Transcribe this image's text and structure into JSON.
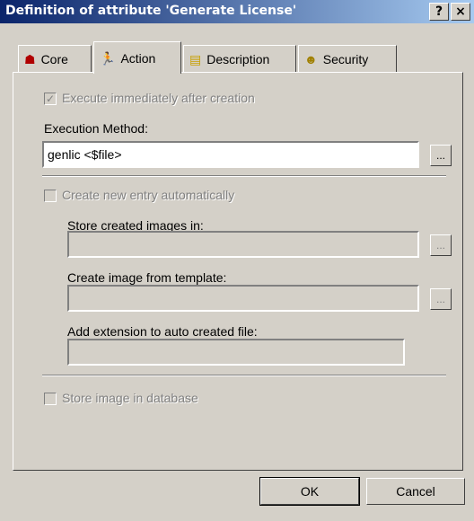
{
  "window": {
    "title": "Definition of attribute 'Generate License'",
    "help_glyph": "?",
    "close_glyph": "×"
  },
  "tabs": [
    {
      "label": "Core",
      "icon": "core-icon",
      "glyph": "☗",
      "icon_color": "#b00000",
      "active": false
    },
    {
      "label": "Action",
      "icon": "running-man-icon",
      "glyph": "🏃",
      "icon_color": "#000000",
      "active": true
    },
    {
      "label": "Description",
      "icon": "note-icon",
      "glyph": "▤",
      "icon_color": "#c8a000",
      "active": false
    },
    {
      "label": "Security",
      "icon": "people-icon",
      "glyph": "☻",
      "icon_color": "#a08000",
      "active": false
    }
  ],
  "action": {
    "execute_immediately": {
      "label": "Execute immediately after creation",
      "checked": true,
      "check_glyph": "✓",
      "enabled": false
    },
    "execution_method": {
      "label": "Execution Method:",
      "value": "genlic <$file>",
      "browse_label": "..."
    },
    "create_new_entry": {
      "label": "Create new entry automatically",
      "checked": false,
      "enabled": false
    },
    "store_created_images": {
      "label": "Store created images in:",
      "value": "",
      "browse_label": "..."
    },
    "create_from_template": {
      "label": "Create image from template:",
      "value": "",
      "browse_label": "..."
    },
    "add_extension": {
      "label": "Add extension to auto created file:",
      "value": ""
    },
    "store_in_database": {
      "label": "Store image in database",
      "checked": false,
      "enabled": false
    }
  },
  "buttons": {
    "ok_label": "OK",
    "cancel_label": "Cancel"
  }
}
